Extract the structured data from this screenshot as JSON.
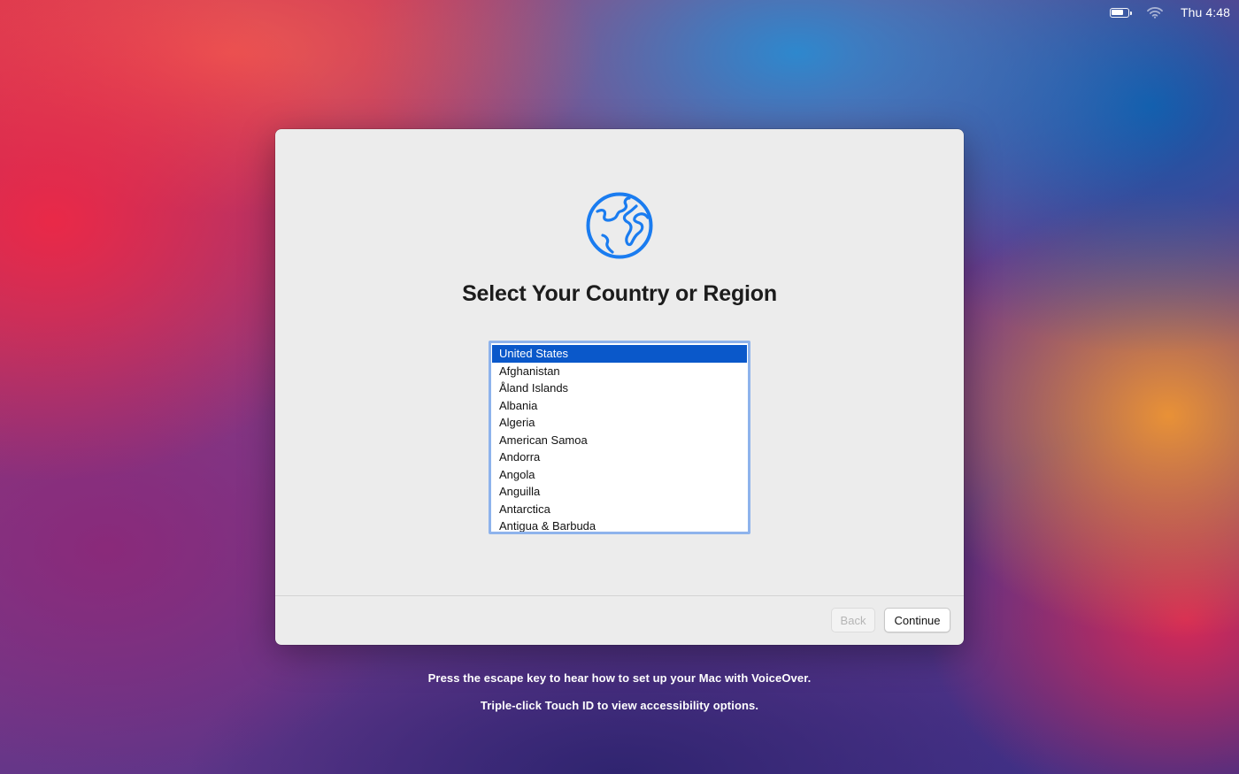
{
  "menubar": {
    "battery_level": 0.75,
    "clock": "Thu 4:48"
  },
  "window": {
    "title": "Select Your Country or Region",
    "countries": [
      "United States",
      "Afghanistan",
      "Åland Islands",
      "Albania",
      "Algeria",
      "American Samoa",
      "Andorra",
      "Angola",
      "Anguilla",
      "Antarctica",
      "Antigua & Barbuda"
    ],
    "selected": "United States",
    "buttons": {
      "back": "Back",
      "continue": "Continue"
    }
  },
  "hints": {
    "voiceover": "Press the escape key to hear how to set up your Mac with VoiceOver.",
    "accessibility": "Triple-click Touch ID to view accessibility options."
  },
  "colors": {
    "accent": "#0a58ca",
    "globe": "#1a7cf0",
    "list_focus_ring": "#8eb3ec"
  }
}
